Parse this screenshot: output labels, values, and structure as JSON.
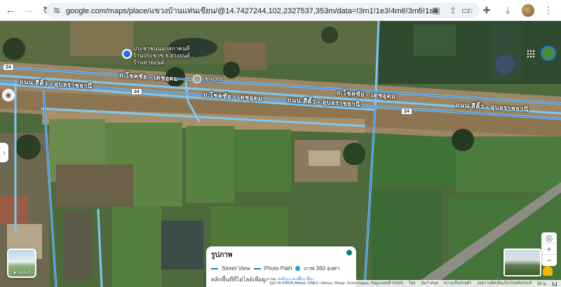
{
  "browser": {
    "url": "google.com/maps/place/แขวงบ้านแท่นเขียน/@14.7427244,102.2327537,353m/data=!3m1!1e3!4m6!3m5!1s0x311bfdb1c8358297:0xf3ed8f9f8d6244..."
  },
  "map": {
    "road_labels": [
      {
        "text": "ถ.โชคชัย - เดชอุดม"
      },
      {
        "text": "ถ.โชคชัย - เดชอุดม"
      },
      {
        "text": "ถ.โชคชัย - เดชอุดม"
      },
      {
        "text": "ถนน สีคิ้ว - อุบลราชธานี"
      },
      {
        "text": "ถนน สีคิ้ว - อุบลราชธานี"
      },
      {
        "text": "ถนน สีคิ้ว - อุบลราชธานี"
      }
    ],
    "route_shields": [
      "24",
      "24",
      "24"
    ],
    "place_marker": {
      "line1": "ประชาชนนอกสภาคนที่",
      "line2": "ร้านประชาช ธ.ยางยนต์...",
      "line3": "ร้านขายยนต์"
    },
    "point_label": "เชนยุทธ"
  },
  "layers": {
    "label": "เลเยอร์"
  },
  "photo_panel": {
    "title": "รูปภาพ",
    "street_view": "Street View",
    "photo_path": "Photo Path",
    "photo_360": "ภาพ 360 องศา",
    "hint": "คลิกพื้นที่ที่ไฮไลต์เพื่อดูภาพ",
    "link": "ดูข้อมูลเพิ่มเติม"
  },
  "controls": {
    "zoom_in": "+",
    "zoom_out": "−",
    "locate": "◎"
  },
  "footer": {
    "imagery": "รูปภาพ ©2026 Airbus, CNES / Airbus, Maxar Technologies, ข้อมูลแผนที่ ©2026",
    "country": "ไทย",
    "terms": "ข้อกำหนด",
    "privacy": "ความเป็นส่วนตัว",
    "feedback": "ส่งความคิดเห็นเกี่ยวกับผลิตภัณฑ์",
    "scale": "50 ม."
  },
  "colors": {
    "road_highlight": "#7cc8f5",
    "accent": "#1a73e8"
  }
}
